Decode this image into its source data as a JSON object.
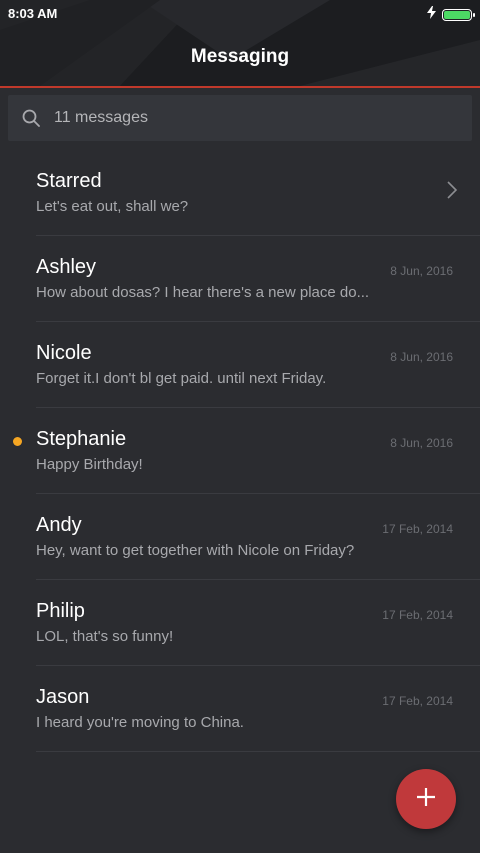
{
  "status": {
    "time": "8:03 AM",
    "battery_level": 1.0,
    "charging": true
  },
  "header": {
    "title": "Messaging"
  },
  "search": {
    "text": "11 messages"
  },
  "starred": {
    "name": "Starred",
    "preview": "Let's eat out, shall we?"
  },
  "conversations": [
    {
      "name": "Ashley",
      "preview": "How about dosas? I hear there's a new place do...",
      "date": "8 Jun, 2016",
      "unread": false
    },
    {
      "name": "Nicole",
      "preview": "Forget it.I don't bl get paid. until next Friday.",
      "date": "8 Jun, 2016",
      "unread": false
    },
    {
      "name": "Stephanie",
      "preview": "Happy Birthday!",
      "date": "8 Jun, 2016",
      "unread": true
    },
    {
      "name": "Andy",
      "preview": "Hey, want to get together with Nicole on Friday?",
      "date": "17 Feb, 2014",
      "unread": false
    },
    {
      "name": "Philip",
      "preview": "LOL, that's so funny!",
      "date": "17 Feb, 2014",
      "unread": false
    },
    {
      "name": "Jason",
      "preview": "I heard you're moving to China.",
      "date": "17 Feb, 2014",
      "unread": false
    }
  ],
  "icons": {
    "search": "search-icon",
    "chevron": "chevron-right-icon",
    "fab": "plus-icon",
    "charging": "lightning-icon",
    "battery": "battery-icon"
  },
  "colors": {
    "accent": "#c0393b",
    "unread_dot": "#f5a623",
    "battery_fill": "#4cd964",
    "background": "#2b2c30",
    "header_bg": "#1f2023"
  }
}
